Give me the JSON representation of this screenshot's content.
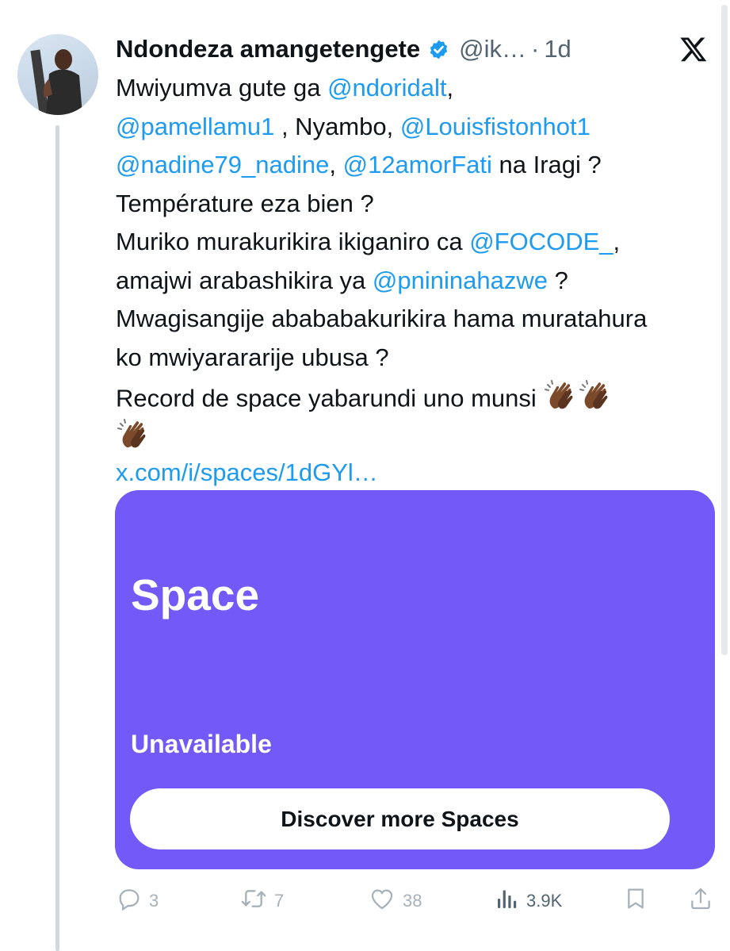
{
  "author": {
    "display_name": "Ndondeza amangetengete",
    "handle": "@ik…",
    "separator": "·",
    "time": "1d",
    "verified": true
  },
  "tweet": {
    "lines": [
      [
        {
          "t": "Mwiyumva gute ga "
        },
        {
          "t": "@ndoridalt",
          "k": "mention"
        },
        {
          "t": ","
        }
      ],
      [
        {
          "t": "@pamellamu1",
          "k": "mention"
        },
        {
          "t": " , Nyambo, "
        },
        {
          "t": "@Louisfistonhot1",
          "k": "mention"
        }
      ],
      [
        {
          "t": "@nadine79_nadine",
          "k": "mention"
        },
        {
          "t": ", "
        },
        {
          "t": "@12amorFati",
          "k": "mention"
        },
        {
          "t": " na Iragi ?"
        }
      ],
      [
        {
          "t": "Température eza bien ?"
        }
      ],
      [
        {
          "t": "Muriko murakurikira ikiganiro ca "
        },
        {
          "t": "@FOCODE_",
          "k": "mention"
        },
        {
          "t": ","
        }
      ],
      [
        {
          "t": "amajwi arabashikira ya "
        },
        {
          "t": "@pnininahazwe",
          "k": "mention"
        },
        {
          "t": " ?"
        }
      ],
      [
        {
          "t": "Mwagisangije abababakurikira hama muratahura"
        }
      ],
      [
        {
          "t": "ko mwiyarararije ubusa ?"
        }
      ],
      [
        {
          "t": "Record de space yabarundi uno munsi "
        },
        {
          "t": "",
          "k": "clap"
        },
        {
          "t": "",
          "k": "clap"
        }
      ],
      [
        {
          "t": "",
          "k": "clap"
        }
      ],
      [
        {
          "t": "x.com/i/spaces/1dGYl…",
          "k": "link"
        }
      ]
    ]
  },
  "space_card": {
    "title": "Space",
    "status": "Unavailable",
    "button_label": "Discover more Spaces",
    "background_color": "#7359f8"
  },
  "actions": {
    "replies": "3",
    "reposts": "7",
    "likes": "38",
    "views": "3.9K"
  },
  "icons": [
    "verified-badge-icon",
    "x-logo-icon",
    "reply-icon",
    "repost-icon",
    "like-icon",
    "views-icon",
    "bookmark-icon",
    "share-icon",
    "clapping-hands-icon"
  ],
  "colors": {
    "link": "#1d9bf0",
    "verified": "#1d9bf0",
    "muted": "#536471",
    "text": "#0f1419"
  }
}
